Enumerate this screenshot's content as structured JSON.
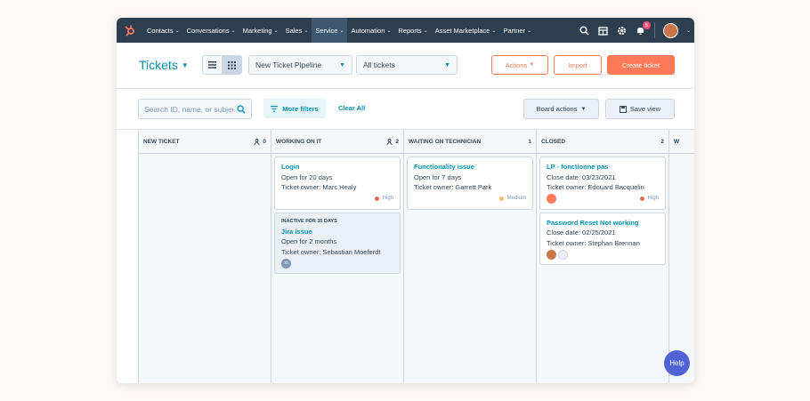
{
  "nav": {
    "items": [
      {
        "label": "Contacts"
      },
      {
        "label": "Conversations"
      },
      {
        "label": "Marketing"
      },
      {
        "label": "Sales"
      },
      {
        "label": "Service"
      },
      {
        "label": "Automation"
      },
      {
        "label": "Reports"
      },
      {
        "label": "Asset Marketplace"
      },
      {
        "label": "Partner"
      }
    ],
    "active": "Service",
    "notification_count": "5"
  },
  "header": {
    "title": "Tickets",
    "pipeline": "New Ticket Pipeline",
    "view_filter": "All tickets",
    "actions_label": "Actions",
    "import_label": "Import",
    "create_label": "Create ticket"
  },
  "filters": {
    "search_placeholder": "Search ID, name, or subject",
    "more_filters": "More filters",
    "clear_all": "Clear All",
    "board_actions": "Board actions",
    "save_view": "Save view"
  },
  "columns": [
    {
      "title": "NEW TICKET",
      "count": "0",
      "cards": []
    },
    {
      "title": "WORKING ON IT",
      "count": "2",
      "cards": [
        {
          "name": "Login",
          "line1": "Open for 20 days",
          "owner_label": "Ticket owner:",
          "owner": "Marc Healy",
          "priority": "High",
          "priority_color": "#e66e50"
        },
        {
          "tag": "INACTIVE FOR 35 DAYS",
          "name": "Jira issue",
          "line1": "Open for 2 months",
          "owner_label": "Ticket owner:",
          "owner": "Sebastian Moeferdt",
          "avatar": "JD"
        }
      ]
    },
    {
      "title": "WAITING ON TECHNICIAN",
      "count": "1",
      "cards": [
        {
          "name": "Functionality issue",
          "line1": "Open for 7 days",
          "owner_label": "Ticket owner:",
          "owner": "Garrett Park",
          "priority": "Medium",
          "priority_color": "#f5c26b"
        }
      ]
    },
    {
      "title": "CLOSED",
      "count": "2",
      "cards": [
        {
          "name": "LP - fonctionne pas",
          "line1": "Close date: 03/23/2021",
          "owner_label": "Ticket owner:",
          "owner": "Edouard Bacquelin",
          "priority": "High",
          "priority_color": "#e66e50"
        },
        {
          "name": "Password Reset Not working",
          "line1": "Close date: 02/25/2021",
          "owner_label": "Ticket owner:",
          "owner": "Stephan Brennan"
        }
      ]
    }
  ],
  "partial_column_label": "W",
  "help_label": "Help",
  "colors": {
    "nav_bg": "#2d3e50",
    "accent": "#ff7a59",
    "link": "#0091ae",
    "help": "#4f62d6"
  }
}
